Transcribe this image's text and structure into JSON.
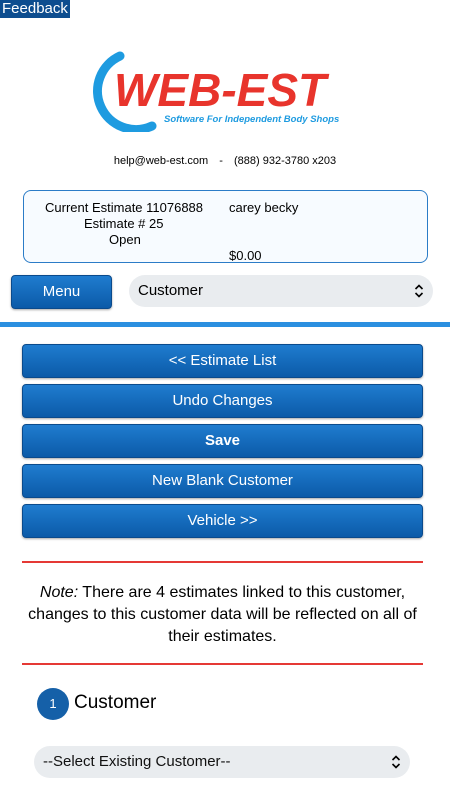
{
  "feedback": {
    "label": "Feedback"
  },
  "logo": {
    "text": "WEB-EST",
    "tagline": "Software For Independent Body Shops",
    "colors": {
      "blue": "#1e9be0",
      "red": "#e8342c"
    }
  },
  "contact": {
    "email": "help@web-est.com",
    "separator": "-",
    "phone": "(888) 932-3780 x203"
  },
  "estimate_summary": {
    "current_estimate": "Current Estimate 11076888",
    "customer_name": "carey becky",
    "estimate_number": "Estimate # 25",
    "status": "Open",
    "total": "$0.00"
  },
  "toolbar": {
    "menu_label": "Menu",
    "page_select_value": "Customer"
  },
  "actions": {
    "estimate_list": "<< Estimate List",
    "undo_changes": "Undo Changes",
    "save": "Save",
    "new_blank_customer": "New Blank Customer",
    "vehicle": "Vehicle >>"
  },
  "note": {
    "label": "Note:",
    "text": " There are 4 estimates linked to this customer, changes to this customer data will be reflected on all of their estimates."
  },
  "customer_section": {
    "step_number": "1",
    "title": "Customer",
    "select_value": "--Select Existing Customer--"
  },
  "colors": {
    "button_blue": "#0b5aa8",
    "divider_blue": "#2b8fe0",
    "divider_red": "#e53935",
    "select_bg": "#e9ecef"
  }
}
